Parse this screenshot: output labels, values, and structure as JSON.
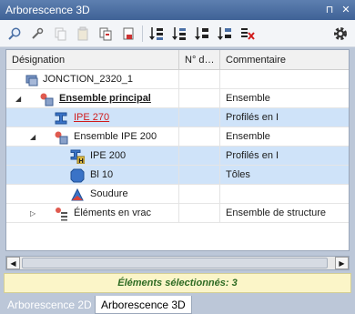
{
  "window": {
    "title": "Arborescence 3D",
    "pin_glyph": "⊓",
    "close_glyph": "✕"
  },
  "toolbar": {
    "buttons": [
      "search-icon",
      "link-icon",
      "copy-icon",
      "paste-icon",
      "duplicate-icon",
      "export-icon",
      "sort-asc-icon",
      "sort-desc-icon",
      "sort-az-icon",
      "sort-za-icon",
      "clear-filter-icon"
    ],
    "settings_icon": "gear-icon"
  },
  "tree": {
    "columns": [
      "Désignation",
      "N° d…",
      "Commentaire"
    ],
    "rows": [
      {
        "name": "JONCTION_2320_1",
        "num": "",
        "comment": "",
        "expander": ""
      },
      {
        "name": "Ensemble principal",
        "num": "",
        "comment": "Ensemble",
        "expander": "◢"
      },
      {
        "name": "IPE 270",
        "num": "",
        "comment": "Profilés en I",
        "expander": ""
      },
      {
        "name": "Ensemble IPE 200",
        "num": "",
        "comment": "Ensemble",
        "expander": "◢"
      },
      {
        "name": "IPE 200",
        "num": "",
        "comment": "Profilés en I",
        "expander": ""
      },
      {
        "name": "Bl 10",
        "num": "",
        "comment": "Tôles",
        "expander": ""
      },
      {
        "name": "Soudure",
        "num": "",
        "comment": "",
        "expander": ""
      },
      {
        "name": "Éléments en vrac",
        "num": "",
        "comment": "Ensemble de structure",
        "expander": "▷"
      }
    ]
  },
  "scrollbar": {
    "left_arrow": "◀",
    "right_arrow": "▶"
  },
  "status": {
    "text": "Éléments sélectionnés: 3"
  },
  "tabs": [
    "Arborescence 2D",
    "Arborescence 3D"
  ],
  "colors": {
    "titlebar": "#4a6ea3",
    "selection": "#cfe3f9",
    "status_bg": "#fbf5c8",
    "status_text": "#2e6b23",
    "link_red": "#d11b1b"
  }
}
